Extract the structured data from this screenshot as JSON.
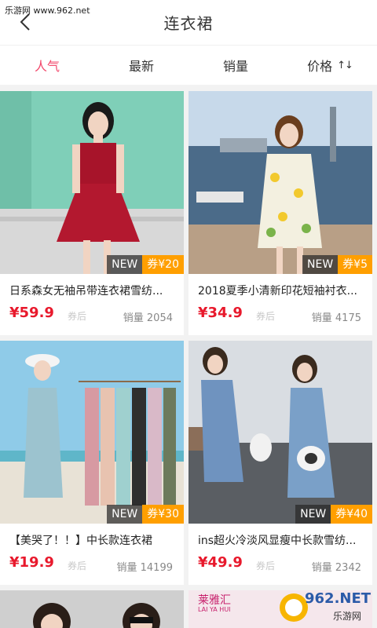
{
  "watermark_top": "乐游网 www.962.net",
  "header": {
    "title": "连衣裙"
  },
  "tabs": [
    {
      "label": "人气",
      "active": true
    },
    {
      "label": "最新",
      "active": false
    },
    {
      "label": "销量",
      "active": false
    },
    {
      "label": "价格",
      "active": false,
      "icon": "sort-icon"
    }
  ],
  "products": [
    {
      "title": "日系森女无袖吊带连衣裙雪纺...",
      "price": "¥59.9",
      "coupon_after": "券后",
      "sales": "销量 2054",
      "badge_new": "NEW",
      "badge_coupon": "券¥20"
    },
    {
      "title": "2018夏季小清新印花短袖衬衣...",
      "price": "¥34.9",
      "coupon_after": "券后",
      "sales": "销量 4175",
      "badge_new": "NEW",
      "badge_coupon": "券¥5"
    },
    {
      "title": "【美哭了！！】中长款连衣裙",
      "price": "¥19.9",
      "coupon_after": "券后",
      "sales": "销量 14199",
      "badge_new": "NEW",
      "badge_coupon": "券¥30"
    },
    {
      "title": "ins超火冷淡风显瘦中长款雪纺...",
      "price": "¥49.9",
      "coupon_after": "券后",
      "sales": "销量 2342",
      "badge_new": "NEW",
      "badge_coupon": "券¥40"
    }
  ],
  "bottom_right_banner": "莱雅汇",
  "bottom_right_banner_sub": "LAI YA HUI",
  "watermark_br": {
    "main": "962.NET",
    "sub": "乐游网"
  },
  "colors": {
    "accent": "#f2486b",
    "price": "#e8192c",
    "coupon": "#ff9f00"
  }
}
